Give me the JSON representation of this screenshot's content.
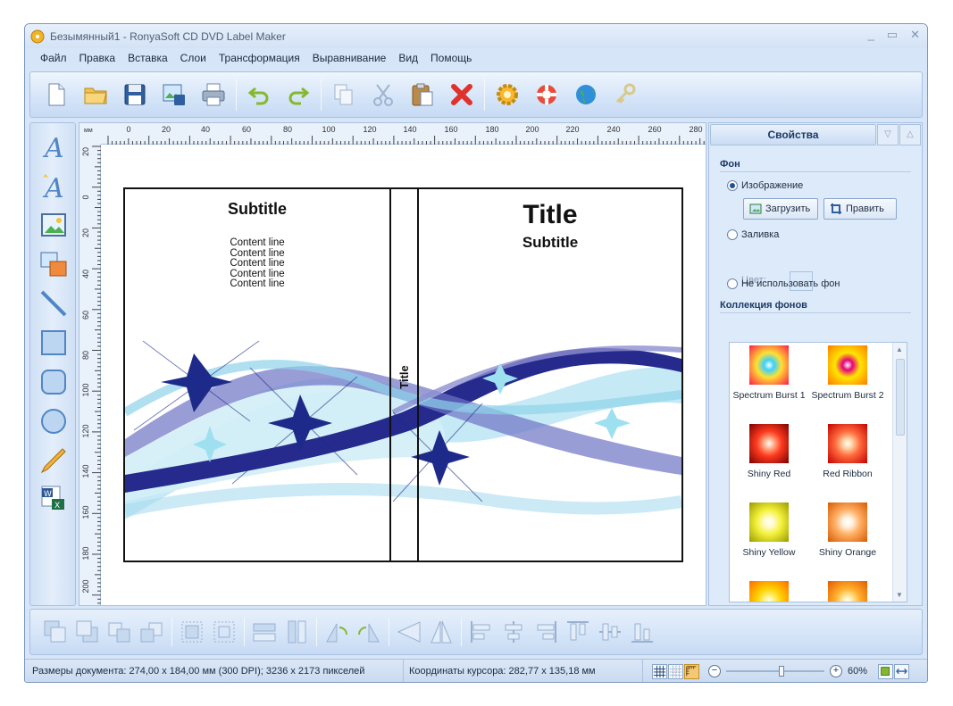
{
  "window": {
    "title": "Безымянный1 - RonyaSoft CD DVD Label Maker",
    "controls": [
      "_",
      "▭",
      "✕"
    ]
  },
  "menu": [
    "Файл",
    "Правка",
    "Вставка",
    "Слои",
    "Трансформация",
    "Выравнивание",
    "Вид",
    "Помощь"
  ],
  "toolbar": {
    "icons": [
      "new-document-icon",
      "open-folder-icon",
      "save-icon",
      "export-image-icon",
      "print-icon",
      "undo-icon",
      "redo-icon",
      "copy-icon",
      "cut-icon",
      "paste-icon",
      "delete-icon",
      "settings-icon",
      "help-lifebuoy-icon",
      "web-globe-icon",
      "key-icon"
    ]
  },
  "left_tools": [
    "text-icon",
    "curved-text-icon",
    "image-icon",
    "image-set-icon",
    "line-icon",
    "rectangle-icon",
    "rounded-rectangle-icon",
    "ellipse-icon",
    "pencil-icon",
    "office-import-icon"
  ],
  "ruler": {
    "unit": "мм",
    "top": [
      "0",
      "20",
      "40",
      "60",
      "80",
      "100",
      "120",
      "140",
      "160",
      "180",
      "200",
      "220",
      "240",
      "260",
      "280"
    ],
    "left": [
      "20",
      "0",
      "20",
      "40",
      "60",
      "80",
      "100",
      "120",
      "140",
      "160",
      "180",
      "200"
    ]
  },
  "label": {
    "back_subtitle": "Subtitle",
    "content_lines": [
      "Content line",
      "Content line",
      "Content line",
      "Content line",
      "Content line"
    ],
    "spine_title": "Title",
    "front_title": "Title",
    "front_subtitle": "Subtitle"
  },
  "panel": {
    "tab": "Свойства",
    "background_section": "Фон",
    "radio_image": "Изображение",
    "btn_load": "Загрузить",
    "btn_edit": "Править",
    "radio_fill": "Заливка",
    "color_label": "Цвет:",
    "radio_none": "Не использовать фон",
    "collection_section": "Коллекция фонов",
    "thumbs": [
      {
        "name": "Spectrum Burst 1",
        "colors": [
          "#ff1a4a",
          "#ffe033",
          "#3ad1ff"
        ]
      },
      {
        "name": "Spectrum Burst 2",
        "colors": [
          "#ff7a00",
          "#ffe600",
          "#e6007a"
        ]
      },
      {
        "name": "Shiny Red",
        "colors": [
          "#7a0000",
          "#ff3b1f",
          "#ffb08a"
        ]
      },
      {
        "name": "Red Ribbon",
        "colors": [
          "#c40000",
          "#ff6a3d",
          "#ffd0a0"
        ]
      },
      {
        "name": "Shiny Yellow",
        "colors": [
          "#9a9a00",
          "#f4f13a",
          "#fffbc9"
        ]
      },
      {
        "name": "Shiny Orange",
        "colors": [
          "#d85a00",
          "#ffb066",
          "#fff1e0"
        ]
      },
      {
        "name": "",
        "colors": [
          "#ff6a00",
          "#ffd000",
          "#fff27a"
        ]
      },
      {
        "name": "",
        "colors": [
          "#e45a00",
          "#ffae2b",
          "#ffe8a0"
        ]
      }
    ]
  },
  "bottom_toolbar": {
    "icons": [
      "bring-to-front-icon",
      "send-to-back-icon",
      "bring-forward-icon",
      "send-backward-icon",
      "group-icon",
      "ungroup-icon",
      "same-width-icon",
      "same-height-icon",
      "rotate-left-icon",
      "rotate-right-icon",
      "flip-horizontal-icon",
      "flip-vertical-icon",
      "align-left-icon",
      "align-center-icon",
      "align-right-icon",
      "align-top-icon",
      "align-middle-icon",
      "align-bottom-icon"
    ]
  },
  "status": {
    "document_size": "Размеры документа: 274,00 x 184,00 мм (300 DPI); 3236 x 2173 пикселей",
    "cursor": "Координаты курсора: 282,77 x 135,18 мм",
    "zoom": "60%",
    "zoom_fraction": 0.6
  }
}
